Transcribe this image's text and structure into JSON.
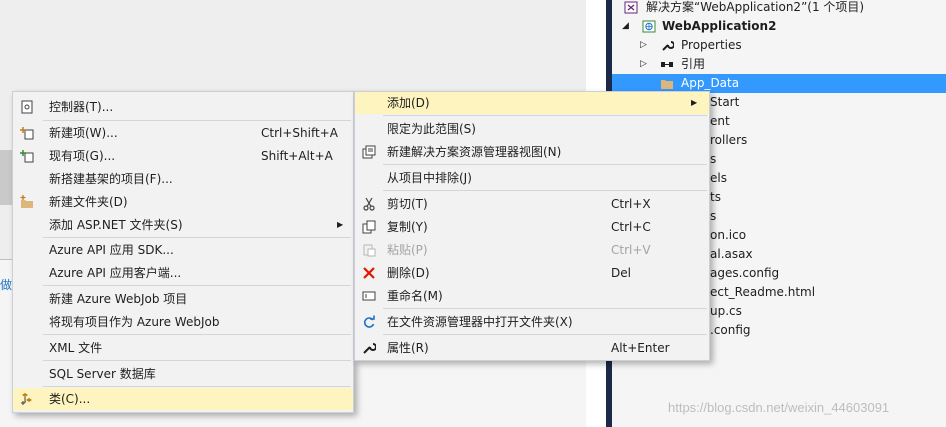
{
  "background": {
    "side_text": "做"
  },
  "solution_explorer": {
    "solution_label": "解决方案“WebApplication2”(1 个项目)",
    "project_label": "WebApplication2",
    "items": [
      {
        "label": "Properties"
      },
      {
        "label": "引用"
      },
      {
        "label": "App_Data"
      },
      {
        "label": "Start"
      },
      {
        "label": "ent"
      },
      {
        "label": "rollers"
      },
      {
        "label": "s"
      },
      {
        "label": "els"
      },
      {
        "label": "ts"
      },
      {
        "label": "s"
      },
      {
        "label": "on.ico"
      },
      {
        "label": "al.asax"
      },
      {
        "label": "ages.config"
      },
      {
        "label": "ect_Readme.html"
      },
      {
        "label": "up.cs"
      },
      {
        "label": ".config"
      }
    ]
  },
  "left_menu": {
    "items": [
      {
        "label": "控制器(T)...",
        "shortcut": "",
        "icon": "controller-icon"
      },
      {
        "label": "新建项(W)...",
        "shortcut": "Ctrl+Shift+A",
        "icon": "new-item-icon"
      },
      {
        "label": "现有项(G)...",
        "shortcut": "Shift+Alt+A",
        "icon": "existing-item-icon"
      },
      {
        "label": "新搭建基架的项目(F)...",
        "shortcut": "",
        "icon": ""
      },
      {
        "label": "新建文件夹(D)",
        "shortcut": "",
        "icon": "new-folder-icon"
      },
      {
        "label": "添加 ASP.NET 文件夹(S)",
        "shortcut": "",
        "icon": ""
      },
      {
        "label": "Azure API 应用 SDK...",
        "shortcut": "",
        "icon": ""
      },
      {
        "label": "Azure API 应用客户端...",
        "shortcut": "",
        "icon": ""
      },
      {
        "label": "新建 Azure WebJob 项目",
        "shortcut": "",
        "icon": ""
      },
      {
        "label": "将现有项目作为 Azure WebJob",
        "shortcut": "",
        "icon": ""
      },
      {
        "label": "XML 文件",
        "shortcut": "",
        "icon": ""
      },
      {
        "label": "SQL Server 数据库",
        "shortcut": "",
        "icon": ""
      },
      {
        "label": "类(C)...",
        "shortcut": "",
        "icon": "class-icon"
      }
    ]
  },
  "right_menu": {
    "items": [
      {
        "label": "添加(D)",
        "shortcut": ""
      },
      {
        "label": "限定为此范围(S)",
        "shortcut": ""
      },
      {
        "label": "新建解决方案资源管理器视图(N)",
        "shortcut": ""
      },
      {
        "label": "从项目中排除(J)",
        "shortcut": ""
      },
      {
        "label": "剪切(T)",
        "shortcut": "Ctrl+X"
      },
      {
        "label": "复制(Y)",
        "shortcut": "Ctrl+C"
      },
      {
        "label": "粘贴(P)",
        "shortcut": "Ctrl+V"
      },
      {
        "label": "删除(D)",
        "shortcut": "Del"
      },
      {
        "label": "重命名(M)",
        "shortcut": ""
      },
      {
        "label": "在文件资源管理器中打开文件夹(X)",
        "shortcut": ""
      },
      {
        "label": "属性(R)",
        "shortcut": "Alt+Enter"
      }
    ]
  },
  "watermark": "https://blog.csdn.net/weixin_44603091",
  "colors": {
    "highlight": "#fdf4bf",
    "selection": "#3399ff",
    "menu_bg": "#f2f2f2"
  }
}
